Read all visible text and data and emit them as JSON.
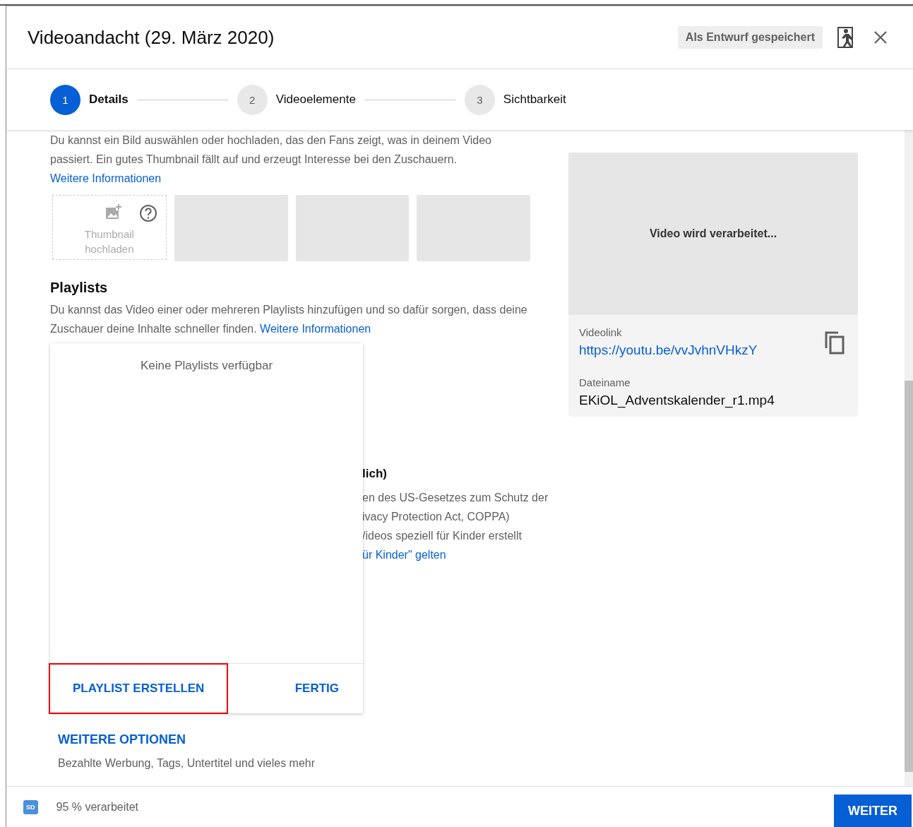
{
  "dialog": {
    "title": "Videoandacht (29. März 2020)",
    "draft_badge": "Als Entwurf gespeichert"
  },
  "steps": [
    {
      "number": "1",
      "label": "Details",
      "selected": true
    },
    {
      "number": "2",
      "label": "Videoelemente",
      "selected": false
    },
    {
      "number": "3",
      "label": "Sichtbarkeit",
      "selected": false
    }
  ],
  "thumbnail_section": {
    "description": "Du kannst ein Bild auswählen oder hochladen, das den Fans zeigt, was in deinem Video passiert. Ein gutes Thumbnail fällt auf und erzeugt Interesse bei den Zuschauern.",
    "link": "Weitere Informationen",
    "upload_label": "Thumbnail hochladen",
    "tiles": [
      {
        "kind": "placeholder"
      },
      {
        "kind": "placeholder"
      },
      {
        "kind": "placeholder"
      }
    ]
  },
  "playlists": {
    "heading": "Playlists",
    "description": "Du kannst das Video einer oder mehreren Playlists hinzufügen und so dafür sorgen, dass deine Zuschauer deine Inhalte schneller finden.",
    "link": "Weitere Informationen"
  },
  "audience_partial": {
    "heading": "lich)",
    "lines": [
      "en des US-Gesetzes zum Schutz der",
      "ivacy Protection Act, COPPA)",
      "/ideos speziell für Kinder erstellt"
    ],
    "link": "ür Kinder\" gelten"
  },
  "playlist_popup": {
    "empty_text": "Keine Playlists verfügbar",
    "buttons": [
      {
        "label": "PLAYLIST ERSTELLEN",
        "highlighted": true
      },
      {
        "label": "FERTIG",
        "highlighted": false
      }
    ]
  },
  "more_options": {
    "label": "WEITERE OPTIONEN",
    "description": "Bezahlte Werbung, Tags, Untertitel und vieles mehr"
  },
  "preview": {
    "status": "Video wird verarbeitet...",
    "link_label": "Videolink",
    "link": "https://youtu.be/vvJvhnVHkzY",
    "filename_label": "Dateiname",
    "filename": "EKiOL_Adventskalender_r1.mp4"
  },
  "footer": {
    "badge": "SD",
    "status": "95 % verarbeitet",
    "next_button": "WEITER"
  }
}
